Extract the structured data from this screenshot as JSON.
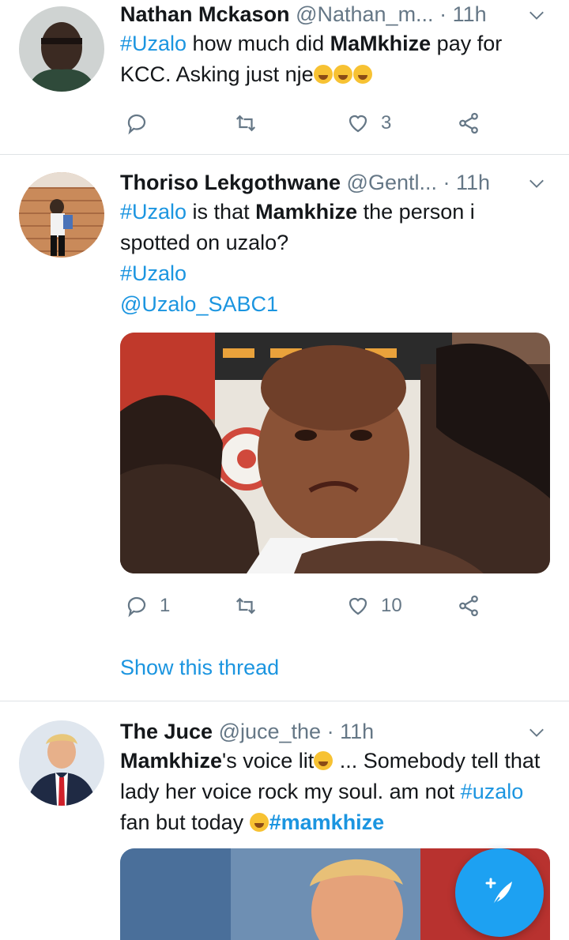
{
  "tweets": [
    {
      "name": "Nathan Mckason",
      "handle": "@Nathan_m...",
      "time": "· 11h",
      "text": {
        "hashtag": "#Uzalo",
        "part1": " how much did ",
        "bold": "MaMkhize",
        "part2": " pay for KCC. Asking just nje"
      },
      "emoji": [
        "laughing-tears",
        "laughing-tears",
        "laughing-tears"
      ],
      "replies": "",
      "retweets": "",
      "likes": "3"
    },
    {
      "name": "Thoriso Lekgothwane",
      "handle": "@Gentl...",
      "time": "· 11h",
      "text": {
        "hashtag": "#Uzalo",
        "part1": " is that ",
        "bold": "Mamkhize",
        "part2": " the person i spotted on uzalo?",
        "hashtag2": "#Uzalo",
        "mention": "@Uzalo_SABC1"
      },
      "replies": "1",
      "retweets": "",
      "likes": "10",
      "show_thread": "Show this thread"
    },
    {
      "name": "The Juce",
      "handle": "@juce_the",
      "time": "· 11h",
      "text": {
        "bold": "Mamkhize",
        "part1": "'s voice lit",
        "part2": " ... Somebody tell that lady her voice rock my soul. am not ",
        "hashtag": "#uzalo",
        "part3": " fan but today ",
        "hashtag2": "#mamkhize"
      }
    }
  ],
  "colors": {
    "link": "#1b95e0",
    "muted": "#657786",
    "fab": "#1da1f2"
  }
}
